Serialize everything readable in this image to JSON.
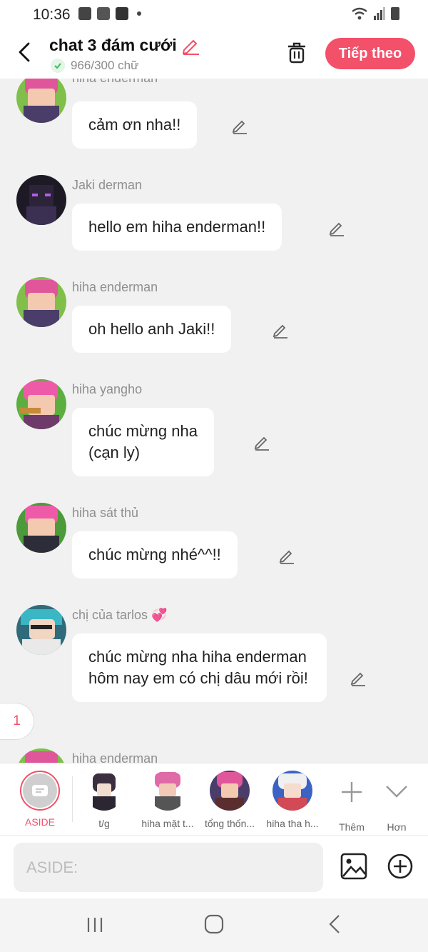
{
  "status_bar": {
    "time": "10:36"
  },
  "header": {
    "title": "chat 3 đám cưới",
    "char_count": "966/300 chữ",
    "next_label": "Tiếp theo"
  },
  "messages": [
    {
      "sender": "hiha enderman",
      "text": "cảm ơn nha!!",
      "avatar_color": "#e0569b"
    },
    {
      "sender": "Jaki derman",
      "text": "hello em hiha enderman!!",
      "avatar_color": "#2a1f3d"
    },
    {
      "sender": "hiha enderman",
      "text": "oh hello anh Jaki!!",
      "avatar_color": "#e0569b"
    },
    {
      "sender": "hiha yangho",
      "text": "chúc mừng nha\n(cạn ly)",
      "avatar_color": "#e0569b"
    },
    {
      "sender": "hiha sát thủ",
      "text": "chúc mừng nhé^^!!",
      "avatar_color": "#e0569b"
    },
    {
      "sender": "chị của tarlos 💞",
      "text": "chúc mừng nha hiha enderman hôm nay em có chị dâu mới rồi!",
      "avatar_color": "#2f6b7a"
    },
    {
      "sender": "hiha enderman"
    }
  ],
  "page_badge": "1",
  "character_bar": {
    "aside_label": "ASIDE",
    "characters": [
      {
        "label": "t/g",
        "color": "#3a2e3f"
      },
      {
        "label": "hiha mặt t...",
        "color": "#e06aa8"
      },
      {
        "label": "tổng thốn...",
        "color": "#e0569b"
      },
      {
        "label": "hiha tha h...",
        "color": "#d24a55"
      }
    ],
    "more_label": "Thêm",
    "less_label": "Hơn"
  },
  "input": {
    "placeholder": "ASIDE:"
  },
  "colors": {
    "accent": "#f3506a",
    "background": "#f1f1f1",
    "bubble": "#ffffff"
  }
}
